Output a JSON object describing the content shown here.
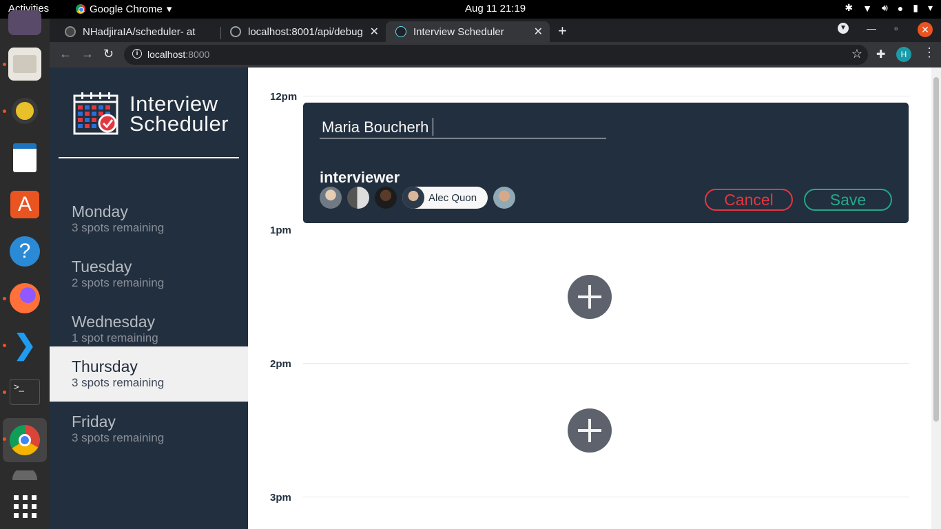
{
  "system": {
    "activities": "Activities",
    "app_name": "Google Chrome",
    "clock": "Aug 11  21:19"
  },
  "dock": {
    "items": [
      "thunderbird-icon",
      "files-icon",
      "rhythmbox-icon",
      "writer-icon",
      "software-icon",
      "help-icon",
      "firefox-icon",
      "vscode-icon",
      "terminal-icon",
      "chrome-icon",
      "trash-icon"
    ],
    "apps_grid_icon": "apps-grid-icon"
  },
  "browser": {
    "tabs": [
      {
        "title": "NHadjiraIA/scheduler- at",
        "active": false
      },
      {
        "title": "localhost:8001/api/debug",
        "active": false
      },
      {
        "title": "Interview Scheduler",
        "active": true
      }
    ],
    "url_host": "localhost",
    "url_rest": ":8000",
    "profile_initial": "H"
  },
  "app": {
    "brand_line1": "Interview",
    "brand_line2": "Scheduler",
    "days": [
      {
        "name": "Monday",
        "spots": "3 spots remaining",
        "selected": false
      },
      {
        "name": "Tuesday",
        "spots": "2 spots remaining",
        "selected": false
      },
      {
        "name": "Wednesday",
        "spots": "1 spot remaining",
        "selected": false
      },
      {
        "name": "Thursday",
        "spots": "3 spots remaining",
        "selected": true
      },
      {
        "name": "Friday",
        "spots": "3 spots remaining",
        "selected": false
      }
    ],
    "times": [
      "12pm",
      "1pm",
      "2pm",
      "3pm"
    ],
    "form": {
      "student_name": "Maria Boucherh",
      "interviewer_label": "interviewer",
      "selected_interviewer": "Alec Quon",
      "cancel_label": "Cancel",
      "save_label": "Save"
    }
  },
  "colors": {
    "sidebar": "#222f3e",
    "selected_day": "#f0f0f0",
    "cancel": "#e33740",
    "save": "#23a98a",
    "add_button": "#5e626d"
  }
}
